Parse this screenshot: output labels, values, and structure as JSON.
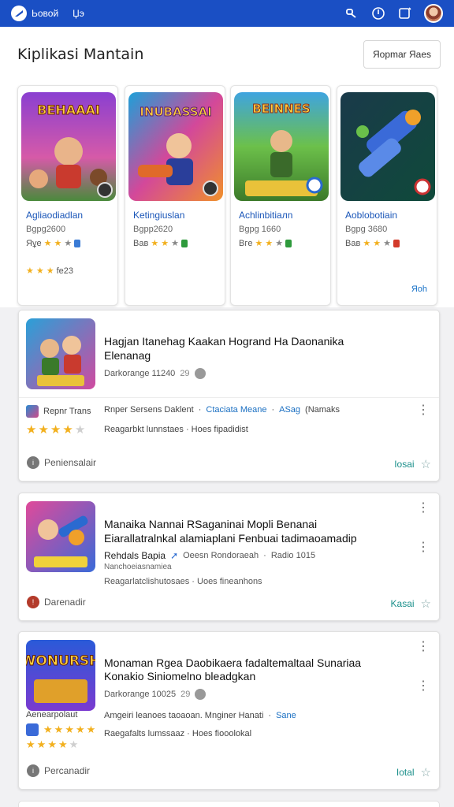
{
  "topbar": {
    "t1": "Ьовой",
    "t2": "Џэ"
  },
  "header": {
    "title": "Kiplikasi Mantain",
    "button_label": "Яоpmar Яaes"
  },
  "featured": [
    {
      "art_text": "BEHAAAI",
      "title": "Agliaodiadlan",
      "sub": "Bgpg2600",
      "rating_prefix": "Яұe",
      "extra": "fe23"
    },
    {
      "art_text": "INUBASSAI",
      "title": "Ketingiuslan",
      "sub": "Bgpp2620",
      "rating_prefix": "Вав"
    },
    {
      "art_text": "BEINNES",
      "title": "Achlinbitiaлn",
      "sub": "Bgpg 1660",
      "rating_prefix": "Вгe"
    },
    {
      "art_text": "",
      "title": "Aoblobotiain",
      "sub": "Bgpg 3680",
      "rating_prefix": "Вав",
      "more": "Яoh"
    }
  ],
  "list": [
    {
      "headline1": "Hagjan Itanehag Kaakan Hogrand Ha Daonanika",
      "headline2": "Elenanag",
      "meta": "Darkorange 11240",
      "meta_num": "29",
      "author": "Repnr Trans",
      "info_plain": "Rnper Sersens Daklent",
      "info_link1": "Ctaciata Meane",
      "info_link2": "ASag",
      "info_tail": "(Namaks",
      "desc": "Reagarbkt lunnstaes · Hoes fipadidist",
      "foot": "Peniensalair",
      "action": "Iosai"
    },
    {
      "headline1": "Manaika Nannai RSaganinai Mopli Benanai",
      "headline2": "Eiarallatralnkal alamiaplani Fenbuai tadimaoamadip",
      "author": "Rehdals Bapia",
      "meta": "Oeesn Rondoraeah",
      "meta_tail": "Radio 1015",
      "subline": "Nanchoeiasnamiea",
      "desc": "Reagarlatclishutosaes · Uoes fineanhons",
      "foot": "Darenadir",
      "action": "Kasai"
    },
    {
      "headline1": "Monaman Rgea Daobikaera fadaltemaltaal Sunariaa",
      "headline2": "Konakio Siniomelno bleadgkan",
      "meta": "Darkorange 10025",
      "meta_num": "29",
      "author": "Aenearpolaut",
      "art_label": "WONURSH",
      "info_plain": "Amgeiri leanoes taoaoan.  Mnginer Hanati",
      "info_link1": "Sane",
      "desc": "Raegafalts lumssaaz · Hoes fiooolokal",
      "foot": "Percanadir",
      "action": "Iotal"
    }
  ],
  "colors": {
    "brand": "#1a4fc4",
    "star": "#f2b01e",
    "link": "#1a6fc2",
    "action": "#1a8f8a"
  }
}
